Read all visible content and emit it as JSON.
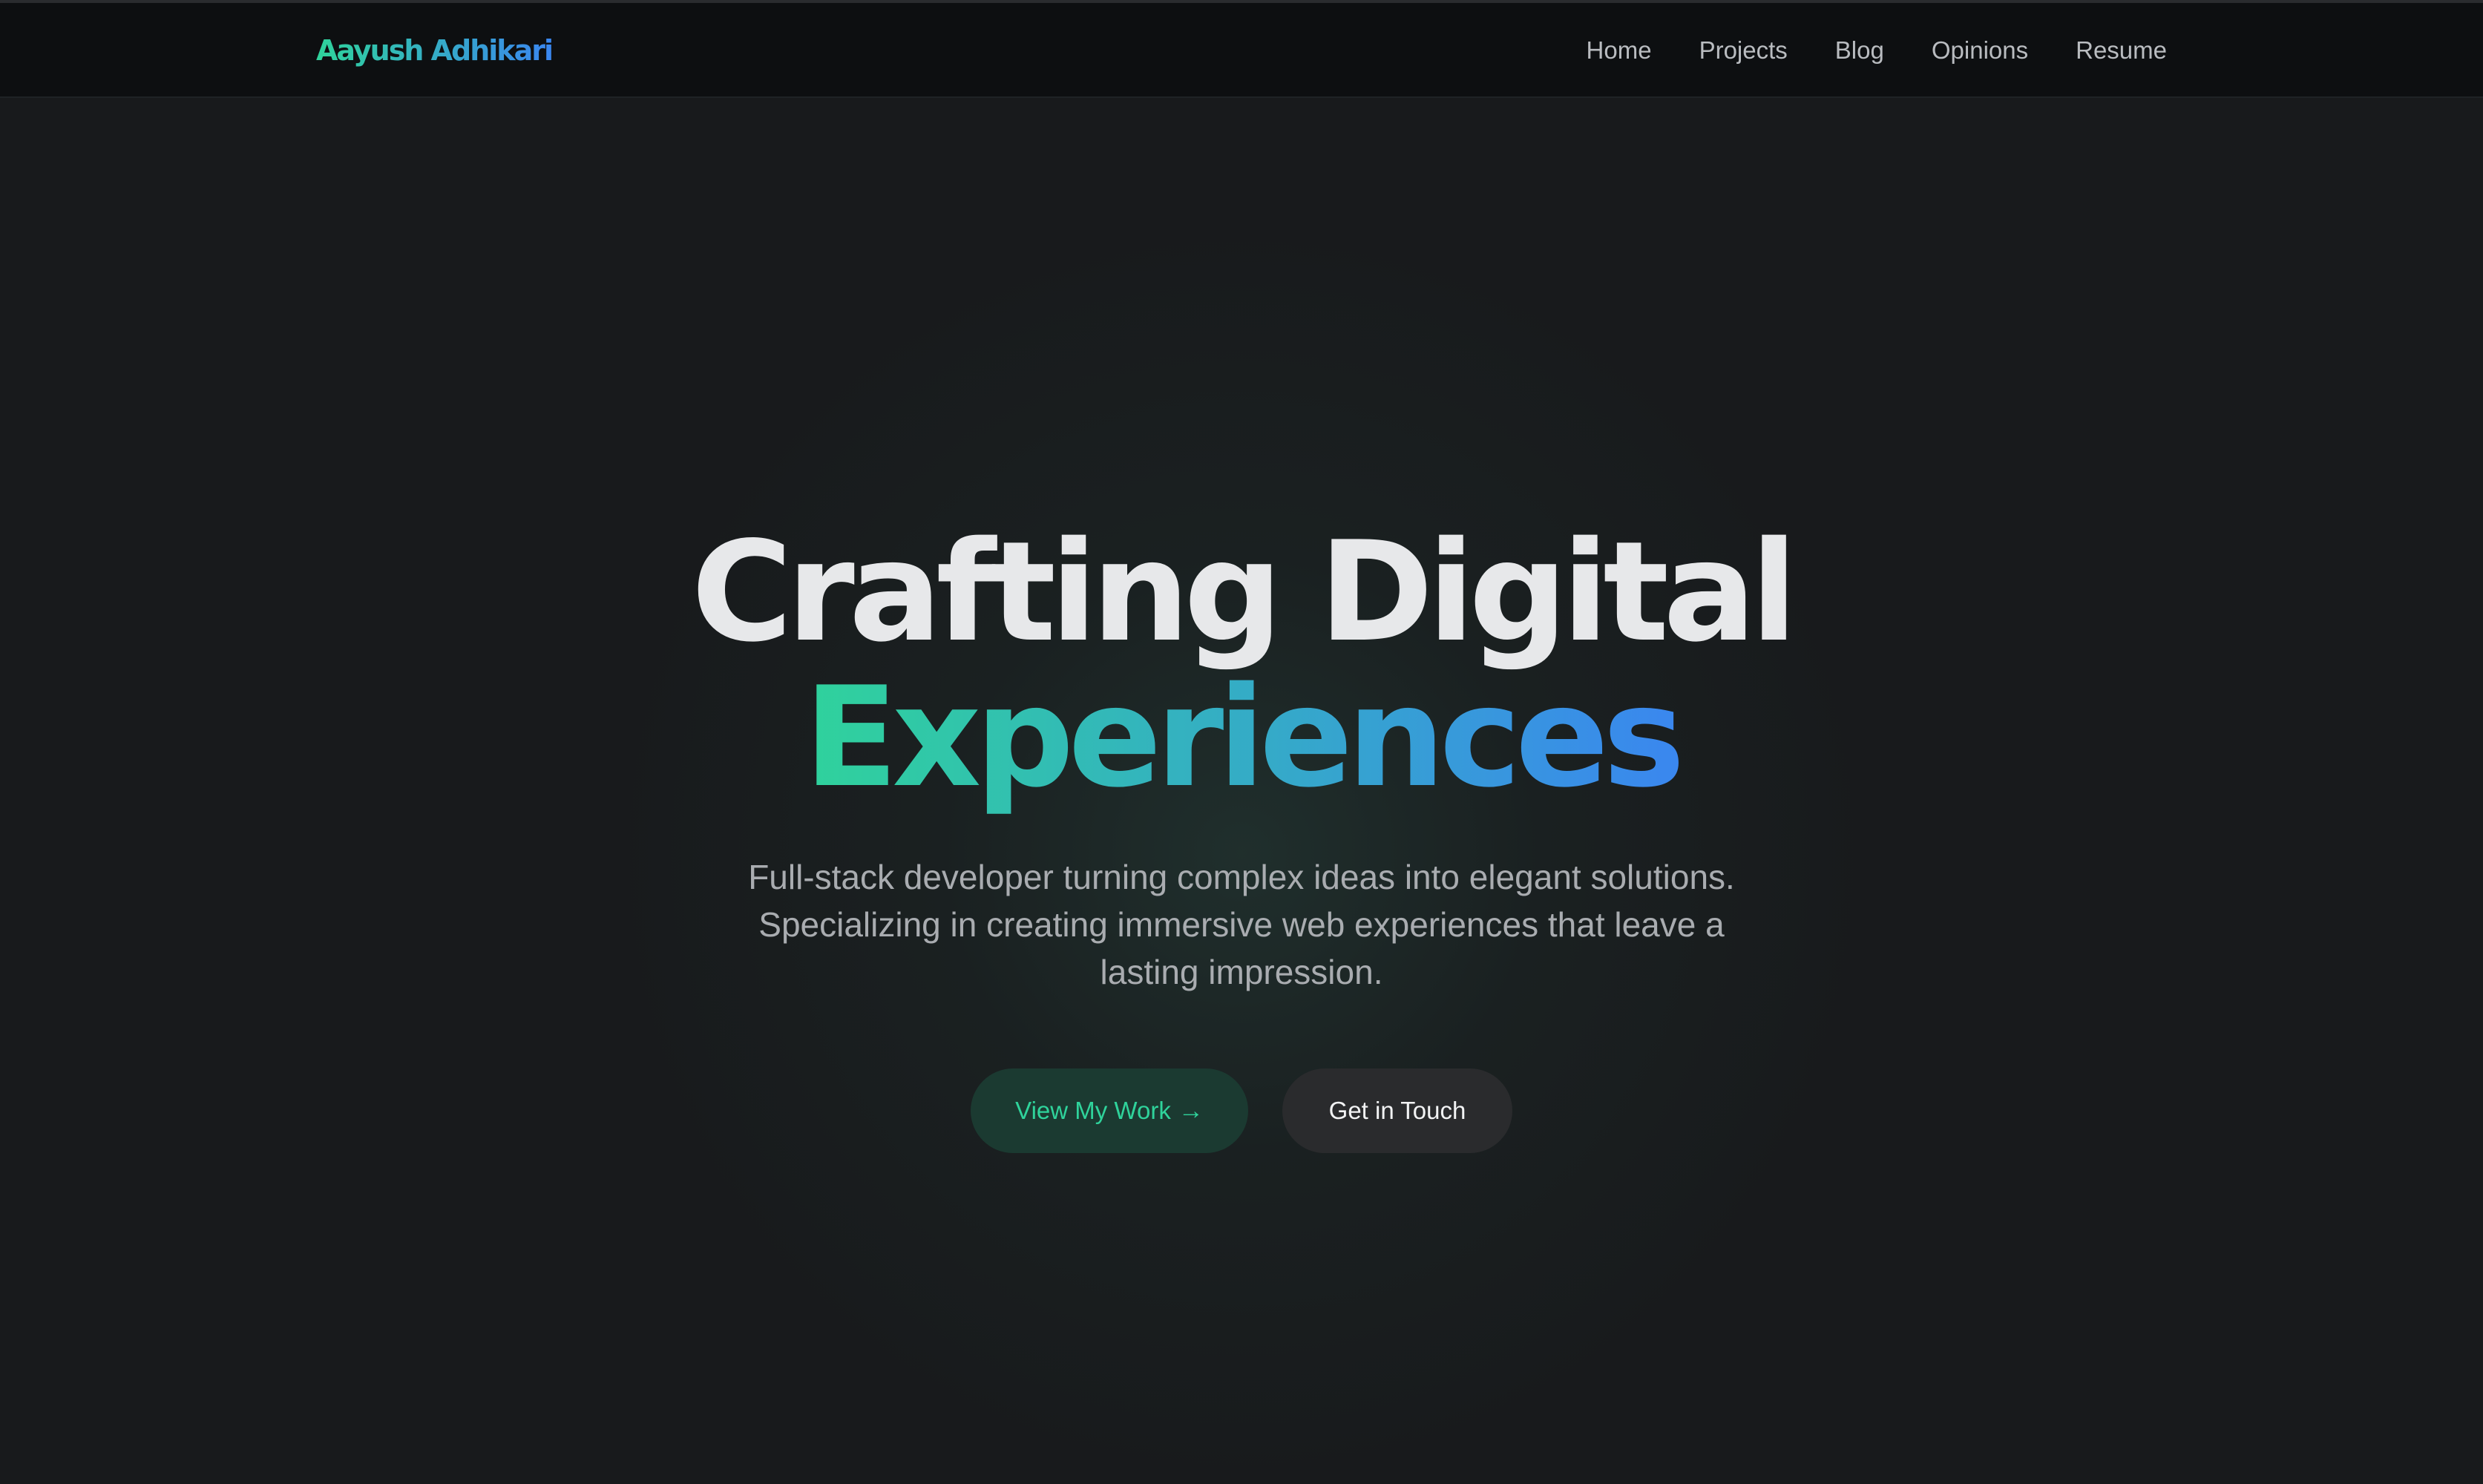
{
  "navbar": {
    "brand": "Aayush Adhikari",
    "links": [
      {
        "label": "Home"
      },
      {
        "label": "Projects"
      },
      {
        "label": "Blog"
      },
      {
        "label": "Opinions"
      },
      {
        "label": "Resume"
      }
    ]
  },
  "hero": {
    "title_line_1": "Crafting Digital",
    "title_line_2": "Experiences",
    "subtitle": "Full-stack developer turning complex ideas into elegant solutions. Specializing in creating immersive web experiences that leave a lasting impression.",
    "primary_cta": "View My Work",
    "primary_cta_icon": "arrow-right-icon",
    "primary_cta_arrow": "→",
    "secondary_cta": "Get in Touch"
  },
  "colors": {
    "background": "#181a1c",
    "navbar": "#0d0f11",
    "accent_green": "#2fd39b",
    "accent_blue": "#3a86f0",
    "text_primary": "#e7e8ea",
    "text_muted": "#a9acb0"
  }
}
